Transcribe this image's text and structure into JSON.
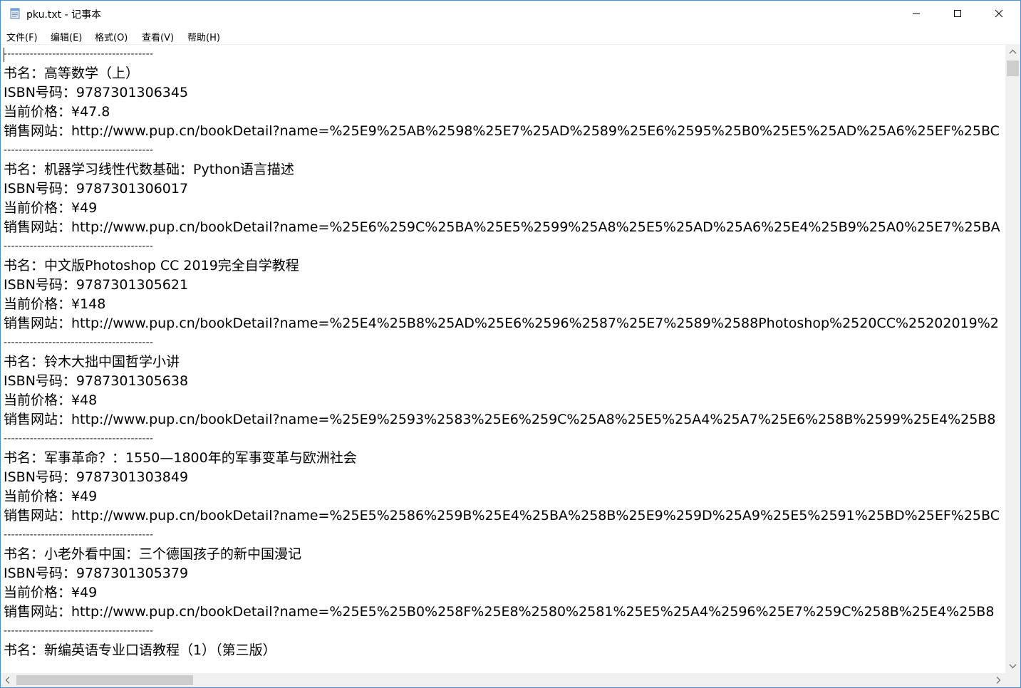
{
  "window": {
    "title": "pku.txt - 记事本"
  },
  "menu": [
    {
      "label": "文件(F)"
    },
    {
      "label": "编辑(E)"
    },
    {
      "label": "格式(O)"
    },
    {
      "label": "查看(V)"
    },
    {
      "label": "帮助(H)"
    }
  ],
  "document": {
    "separator": "----------------------------------------",
    "lines": [
      "----------------------------------------",
      "书名：高等数学（上）",
      "ISBN号码：9787301306345",
      "当前价格：¥47.8",
      "销售网站：http://www.pup.cn/bookDetail?name=%25E9%25AB%2598%25E7%25AD%2589%25E6%2595%25B0%25E5%25AD%25A6%25EF%25BC",
      "----------------------------------------",
      "书名：机器学习线性代数基础：Python语言描述",
      "ISBN号码：9787301306017",
      "当前价格：¥49",
      "销售网站：http://www.pup.cn/bookDetail?name=%25E6%259C%25BA%25E5%2599%25A8%25E5%25AD%25A6%25E4%25B9%25A0%25E7%25BA",
      "----------------------------------------",
      "书名：中文版Photoshop CC 2019完全自学教程",
      "ISBN号码：9787301305621",
      "当前价格：¥148",
      "销售网站：http://www.pup.cn/bookDetail?name=%25E4%25B8%25AD%25E6%2596%2587%25E7%2589%2588Photoshop%2520CC%25202019%2",
      "----------------------------------------",
      "书名：铃木大拙中国哲学小讲",
      "ISBN号码：9787301305638",
      "当前价格：¥48",
      "销售网站：http://www.pup.cn/bookDetail?name=%25E9%2593%2583%25E6%259C%25A8%25E5%25A4%25A7%25E6%258B%2599%25E4%25B8",
      "----------------------------------------",
      "书名：军事革命？：1550—1800年的军事变革与欧洲社会",
      "ISBN号码：9787301303849",
      "当前价格：¥49",
      "销售网站：http://www.pup.cn/bookDetail?name=%25E5%2586%259B%25E4%25BA%258B%25E9%259D%25A9%25E5%2591%25BD%25EF%25BC",
      "----------------------------------------",
      "书名：小老外看中国：三个德国孩子的新中国漫记",
      "ISBN号码：9787301305379",
      "当前价格：¥49",
      "销售网站：http://www.pup.cn/bookDetail?name=%25E5%25B0%258F%25E8%2580%2581%25E5%25A4%2596%25E7%259C%258B%25E4%25B8",
      "----------------------------------------",
      "书名：新编英语专业口语教程（1）（第三版）"
    ]
  },
  "colors": {
    "window_border": "#4a90d9",
    "scrollbar_track": "#f0f0f0",
    "scrollbar_thumb": "#cdcdcd"
  },
  "icons": {
    "app": "notepad-icon",
    "minimize": "minimize-icon",
    "maximize": "maximize-icon",
    "close": "close-icon"
  }
}
